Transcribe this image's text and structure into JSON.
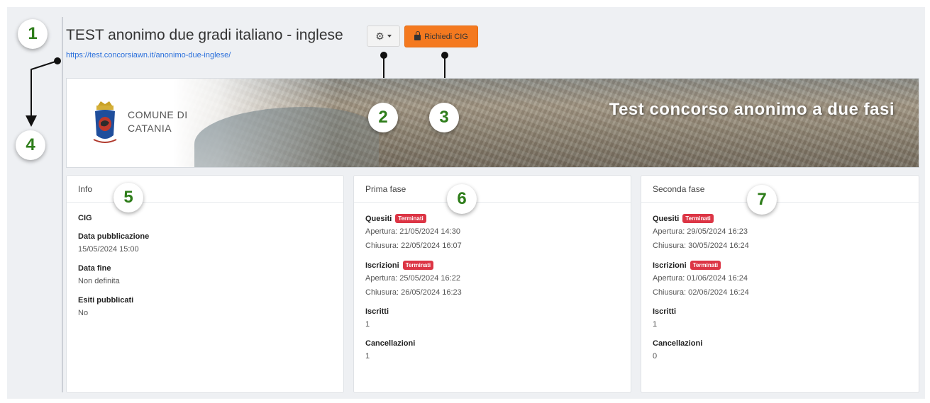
{
  "header": {
    "title": "TEST anonimo due gradi italiano - inglese",
    "url": "https://test.concorsiawn.it/anonimo-due-inglese/",
    "settings_icon": "gear-icon",
    "cig_button_label": "Richiedi CIG",
    "cig_button_icon": "lock-icon",
    "cig_button_color": "#f4791f"
  },
  "banner": {
    "comune_line1": "COMUNE DI",
    "comune_line2": "CATANIA",
    "title": "Test concorso anonimo a due fasi"
  },
  "callouts": [
    "1",
    "2",
    "3",
    "4",
    "5",
    "6",
    "7"
  ],
  "cards": {
    "info": {
      "heading": "Info",
      "cig_label": "CIG",
      "pub_label": "Data pubblicazione",
      "pub_value": "15/05/2024 15:00",
      "end_label": "Data fine",
      "end_value": "Non definita",
      "esiti_label": "Esiti pubblicati",
      "esiti_value": "No"
    },
    "prima": {
      "heading": "Prima fase",
      "quesiti_label": "Quesiti",
      "quesiti_badge": "Terminati",
      "quesiti_apertura": "Apertura: 21/05/2024 14:30",
      "quesiti_chiusura": "Chiusura: 22/05/2024 16:07",
      "iscrizioni_label": "Iscrizioni",
      "iscrizioni_badge": "Terminati",
      "iscrizioni_apertura": "Apertura: 25/05/2024 16:22",
      "iscrizioni_chiusura": "Chiusura: 26/05/2024 16:23",
      "iscritti_label": "Iscritti",
      "iscritti_value": "1",
      "cancellazioni_label": "Cancellazioni",
      "cancellazioni_value": "1"
    },
    "seconda": {
      "heading": "Seconda fase",
      "quesiti_label": "Quesiti",
      "quesiti_badge": "Terminati",
      "quesiti_apertura": "Apertura: 29/05/2024 16:23",
      "quesiti_chiusura": "Chiusura: 30/05/2024 16:24",
      "iscrizioni_label": "Iscrizioni",
      "iscrizioni_badge": "Terminati",
      "iscrizioni_apertura": "Apertura: 01/06/2024 16:24",
      "iscrizioni_chiusura": "Chiusura: 02/06/2024 16:24",
      "iscritti_label": "Iscritti",
      "iscritti_value": "1",
      "cancellazioni_label": "Cancellazioni",
      "cancellazioni_value": "0"
    }
  },
  "colors": {
    "badge": "#dc3545",
    "callout_number": "#2e7d1a",
    "link": "#2a6fdb"
  }
}
